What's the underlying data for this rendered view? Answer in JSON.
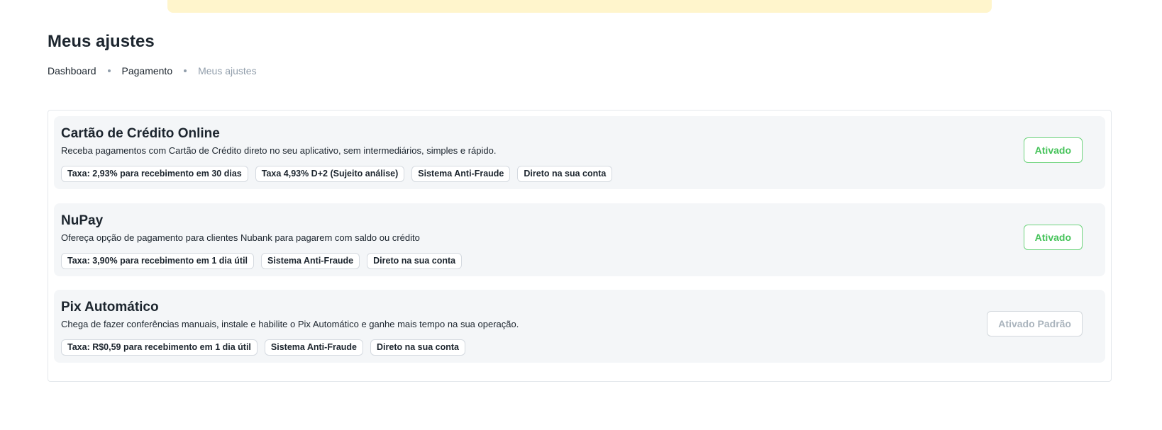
{
  "page": {
    "title": "Meus ajustes"
  },
  "breadcrumb": [
    {
      "label": "Dashboard"
    },
    {
      "label": "Pagamento"
    },
    {
      "label": "Meus ajustes"
    }
  ],
  "methods": [
    {
      "title": "Cartão de Crédito Online",
      "description": "Receba pagamentos com Cartão de Crédito direto no seu aplicativo, sem intermediários, simples e rápido.",
      "tags": [
        "Taxa: 2,93% para recebimento em 30 dias",
        "Taxa 4,93% D+2 (Sujeito análise)",
        "Sistema Anti-Fraude",
        "Direto na sua conta"
      ],
      "status_label": "Ativado"
    },
    {
      "title": "NuPay",
      "description": "Ofereça opção de pagamento para clientes Nubank para pagarem com saldo ou crédito",
      "tags": [
        "Taxa: 3,90% para recebimento em 1 dia útil",
        "Sistema Anti-Fraude",
        "Direto na sua conta"
      ],
      "status_label": "Ativado"
    },
    {
      "title": "Pix Automático",
      "description": "Chega de fazer conferências manuais, instale e habilite o Pix Automático e ganhe mais tempo na sua operação.",
      "tags": [
        "Taxa: R$0,59 para recebimento em 1 dia útil",
        "Sistema Anti-Fraude",
        "Direto na sua conta"
      ],
      "status_label": "Ativado Padrão"
    }
  ],
  "colors": {
    "active_green": "#46c35a",
    "banner_yellow": "#fff5cc",
    "muted_gray": "#919eab"
  }
}
